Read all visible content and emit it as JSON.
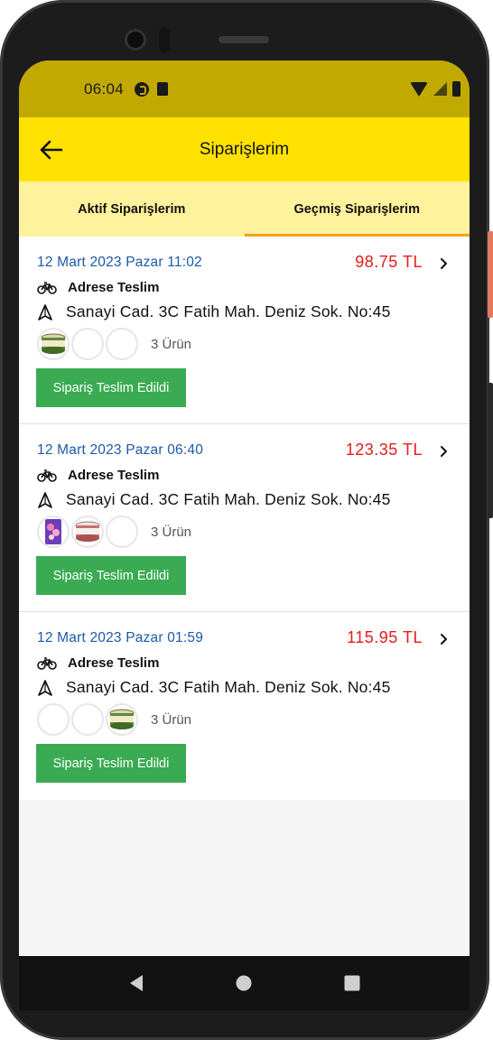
{
  "status_bar": {
    "time": "06:04",
    "icons": [
      "pocket-casts-icon",
      "sd-card-icon",
      "wifi-icon",
      "signal-icon",
      "battery-icon"
    ]
  },
  "app_bar": {
    "title": "Siparişlerim",
    "back_icon": "arrow-left-icon"
  },
  "tabs": [
    {
      "label": "Aktif Siparişlerim",
      "active": false
    },
    {
      "label": "Geçmiş Siparişlerim",
      "active": true
    }
  ],
  "orders": [
    {
      "date": "12 Mart 2023 Pazar 11:02",
      "price": "98.75 TL",
      "delivery": "Adrese Teslim",
      "address": "Sanayi Cad. 3C Fatih Mah. Deniz Sok. No:45",
      "product_count": "3 Ürün",
      "thumbnails": [
        "tin-can",
        "empty",
        "empty"
      ],
      "status": "Sipariş Teslim Edildi"
    },
    {
      "date": "12 Mart 2023 Pazar 06:40",
      "price": "123.35 TL",
      "delivery": "Adrese Teslim",
      "address": "Sanayi Cad. 3C Fatih Mah. Deniz Sok. No:45",
      "product_count": "3 Ürün",
      "thumbnails": [
        "purple-pack",
        "tin-can",
        "empty"
      ],
      "status": "Sipariş Teslim Edildi"
    },
    {
      "date": "12 Mart 2023 Pazar 01:59",
      "price": "115.95 TL",
      "delivery": "Adrese Teslim",
      "address": "Sanayi Cad. 3C Fatih Mah. Deniz Sok. No:45",
      "product_count": "3 Ürün",
      "thumbnails": [
        "empty",
        "empty",
        "tin-can"
      ],
      "status": "Sipariş Teslim Edildi"
    }
  ],
  "colors": {
    "status_bar": "#c2a900",
    "app_bar": "#ffe100",
    "tabs_bg": "#fff29c",
    "tab_indicator": "#f0a31a",
    "date_text": "#1b5aa8",
    "price_text": "#e41b1b",
    "status_button": "#3aab52"
  },
  "nav_bar": [
    "back-triangle-icon",
    "home-circle-icon",
    "recents-square-icon"
  ]
}
